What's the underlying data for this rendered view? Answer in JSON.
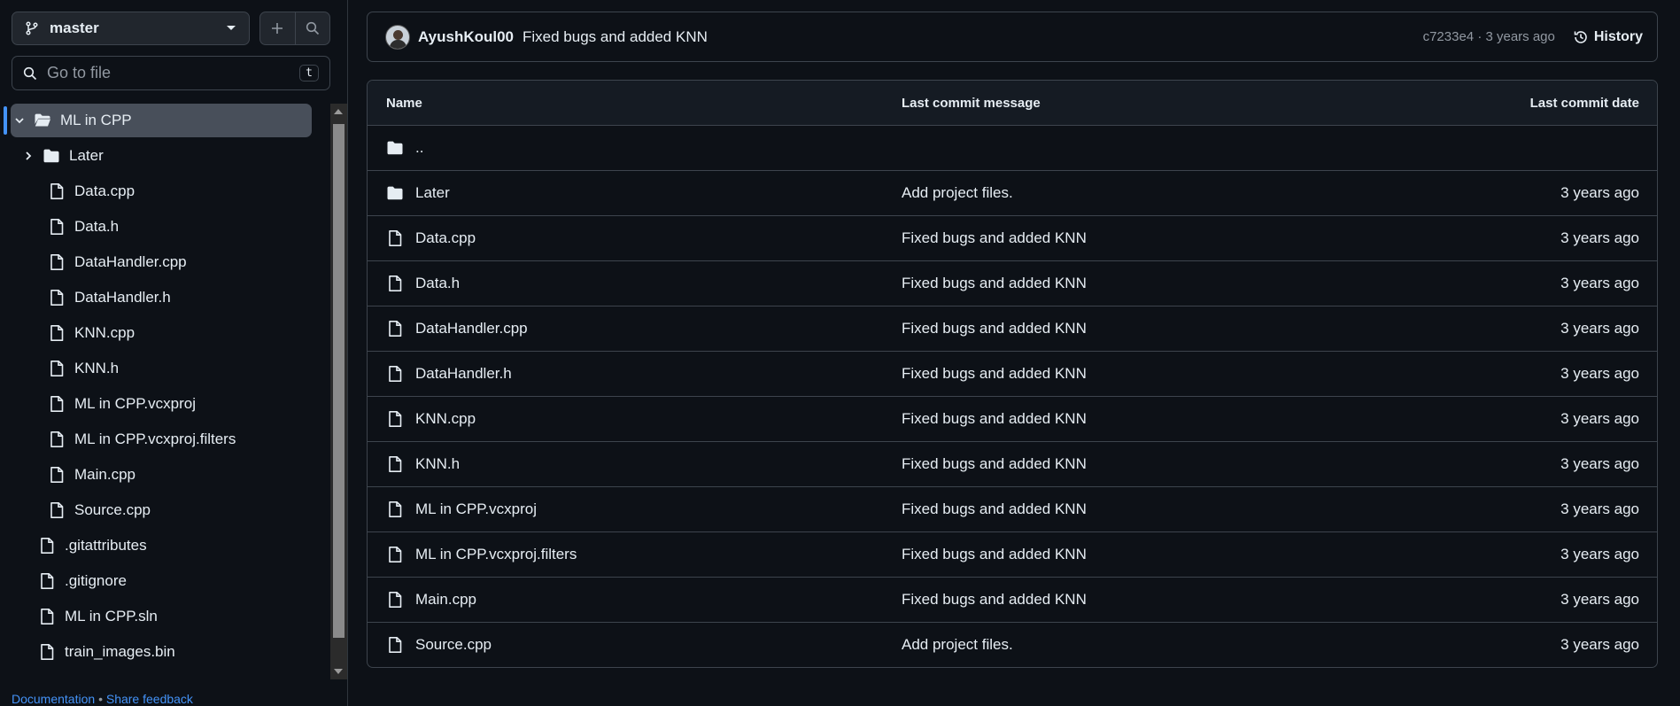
{
  "sidebar": {
    "branch": "master",
    "goto_placeholder": "Go to file",
    "goto_shortcut": "t",
    "tree": [
      {
        "label": "ML in CPP",
        "type": "folder-open",
        "depth": 0,
        "chevron": "down",
        "active": true
      },
      {
        "label": "Later",
        "type": "folder",
        "depth": 1,
        "chevron": "right"
      },
      {
        "label": "Data.cpp",
        "type": "file",
        "depth": 1
      },
      {
        "label": "Data.h",
        "type": "file",
        "depth": 1
      },
      {
        "label": "DataHandler.cpp",
        "type": "file",
        "depth": 1
      },
      {
        "label": "DataHandler.h",
        "type": "file",
        "depth": 1
      },
      {
        "label": "KNN.cpp",
        "type": "file",
        "depth": 1
      },
      {
        "label": "KNN.h",
        "type": "file",
        "depth": 1
      },
      {
        "label": "ML in CPP.vcxproj",
        "type": "file",
        "depth": 1
      },
      {
        "label": "ML in CPP.vcxproj.filters",
        "type": "file",
        "depth": 1
      },
      {
        "label": "Main.cpp",
        "type": "file",
        "depth": 1
      },
      {
        "label": "Source.cpp",
        "type": "file",
        "depth": 1
      },
      {
        "label": ".gitattributes",
        "type": "file",
        "depth": 0
      },
      {
        "label": ".gitignore",
        "type": "file",
        "depth": 0
      },
      {
        "label": "ML in CPP.sln",
        "type": "file",
        "depth": 0
      },
      {
        "label": "train_images.bin",
        "type": "file",
        "depth": 0
      }
    ],
    "footer": {
      "documentation": "Documentation",
      "separator": "•",
      "feedback": "Share feedback"
    }
  },
  "commit": {
    "author": "AyushKoul00",
    "message": "Fixed bugs and added KNN",
    "sha_time": "c7233e4 · 3 years ago",
    "history_label": "History"
  },
  "table": {
    "headers": {
      "name": "Name",
      "message": "Last commit message",
      "date": "Last commit date"
    },
    "rows": [
      {
        "name": "..",
        "type": "folder",
        "message": "",
        "date": ""
      },
      {
        "name": "Later",
        "type": "folder",
        "message": "Add project files.",
        "date": "3 years ago"
      },
      {
        "name": "Data.cpp",
        "type": "file",
        "message": "Fixed bugs and added KNN",
        "date": "3 years ago"
      },
      {
        "name": "Data.h",
        "type": "file",
        "message": "Fixed bugs and added KNN",
        "date": "3 years ago"
      },
      {
        "name": "DataHandler.cpp",
        "type": "file",
        "message": "Fixed bugs and added KNN",
        "date": "3 years ago"
      },
      {
        "name": "DataHandler.h",
        "type": "file",
        "message": "Fixed bugs and added KNN",
        "date": "3 years ago"
      },
      {
        "name": "KNN.cpp",
        "type": "file",
        "message": "Fixed bugs and added KNN",
        "date": "3 years ago"
      },
      {
        "name": "KNN.h",
        "type": "file",
        "message": "Fixed bugs and added KNN",
        "date": "3 years ago"
      },
      {
        "name": "ML in CPP.vcxproj",
        "type": "file",
        "message": "Fixed bugs and added KNN",
        "date": "3 years ago"
      },
      {
        "name": "ML in CPP.vcxproj.filters",
        "type": "file",
        "message": "Fixed bugs and added KNN",
        "date": "3 years ago"
      },
      {
        "name": "Main.cpp",
        "type": "file",
        "message": "Fixed bugs and added KNN",
        "date": "3 years ago"
      },
      {
        "name": "Source.cpp",
        "type": "file",
        "message": "Add project files.",
        "date": "3 years ago"
      }
    ]
  },
  "colors": {
    "background": "#0d1117",
    "border": "#3d444d",
    "accent": "#4493f8",
    "muted": "#9198a1"
  }
}
